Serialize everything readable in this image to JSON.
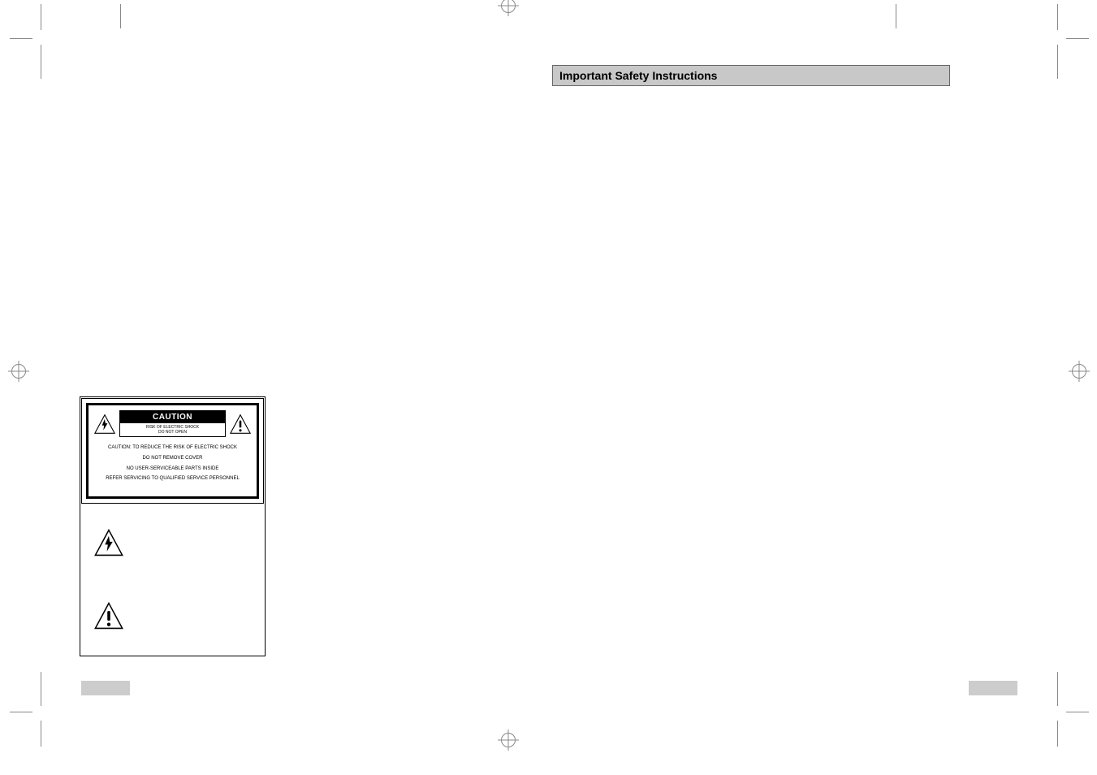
{
  "header": {
    "title": "Important Safety Instructions"
  },
  "caution_box": {
    "title": "CAUTION",
    "subtitle_line1": "RISK OF ELECTRIC SHOCK",
    "subtitle_line2": "DO NOT OPEN",
    "body_line1": "CAUTION: TO REDUCE THE RISK OF ELECTRIC SHOCK",
    "body_line2": "DO NOT REMOVE COVER",
    "body_line3": "NO USER-SERVICEABLE PARTS INSIDE",
    "body_line4": "REFER SERVICING TO QUALIFIED SERVICE PERSONNEL"
  },
  "icons": {
    "lightning": "lightning-bolt-triangle-icon",
    "exclamation": "exclamation-triangle-icon"
  }
}
